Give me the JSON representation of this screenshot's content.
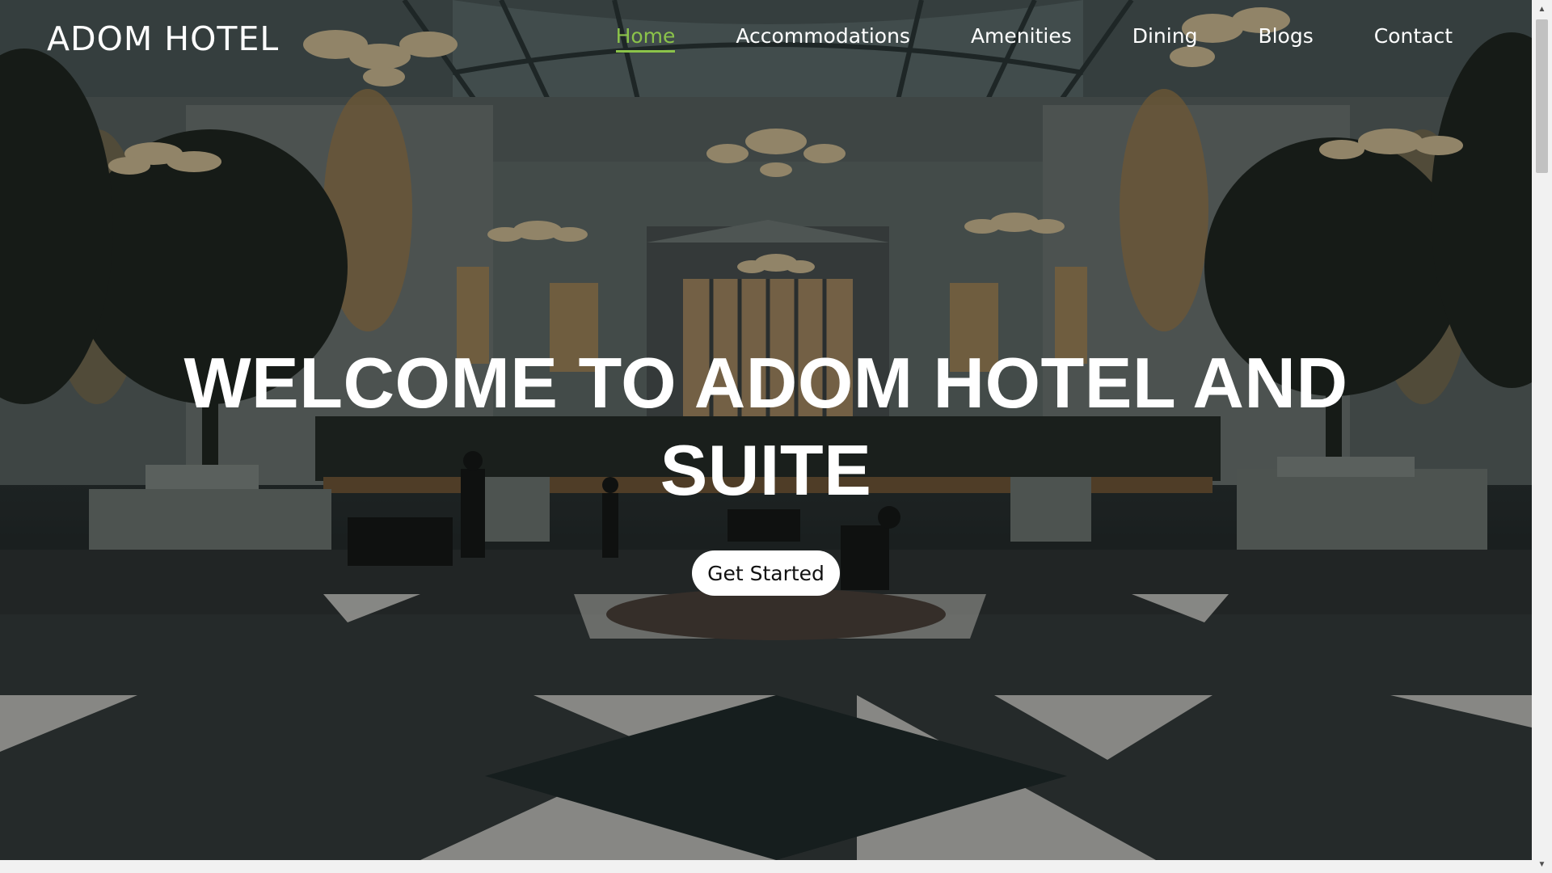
{
  "brand": {
    "logo_text": "ADOM HOTEL"
  },
  "nav": {
    "items": [
      {
        "label": "Home",
        "active": true
      },
      {
        "label": "Accommodations",
        "active": false
      },
      {
        "label": "Amenities",
        "active": false
      },
      {
        "label": "Dining",
        "active": false
      },
      {
        "label": "Blogs",
        "active": false
      },
      {
        "label": "Contact",
        "active": false
      }
    ]
  },
  "hero": {
    "headline_line1": "WELCOME TO ADOM HOTEL AND",
    "headline_line2": "SUITE",
    "cta_label": "Get Started"
  },
  "colors": {
    "accent": "#8bc34a",
    "text": "#ffffff",
    "button_bg": "#ffffff",
    "button_text": "#111111"
  },
  "icons": {
    "scroll_up": "arrow-up-icon",
    "scroll_down": "arrow-down-icon"
  }
}
